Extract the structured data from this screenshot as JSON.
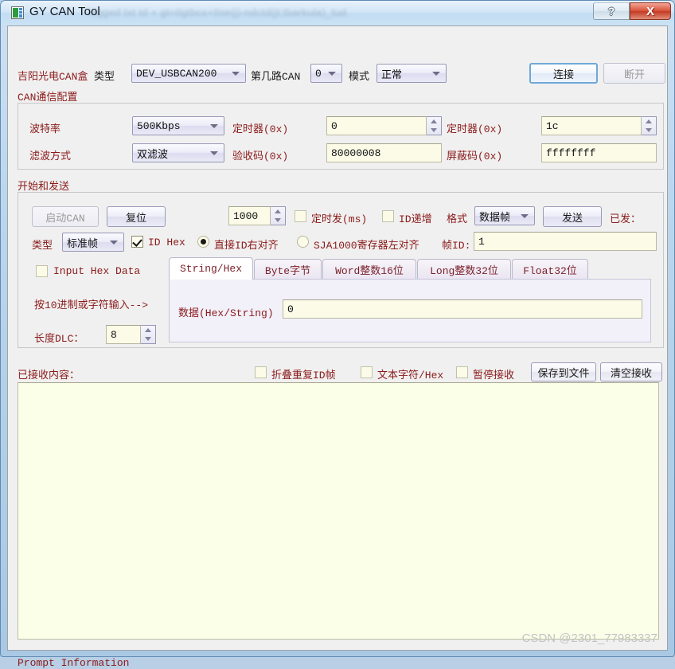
{
  "window": {
    "title": "GY CAN Tool",
    "ghost_title": "logged  txt  td + gt=tlgtbcx+tlse(j)-ndctd(jt;tbarkula)_tud",
    "help_label": "?",
    "close_label": "X"
  },
  "device_row": {
    "brand_label": "吉阳光电CAN盒",
    "type_label": "类型",
    "type_value": "DEV_USBCAN200",
    "channel_label": "第几路CAN",
    "channel_value": "0",
    "mode_label": "模式",
    "mode_value": "正常",
    "connect_label": "连接",
    "disconnect_label": "断开"
  },
  "can_config": {
    "group_title": "CAN通信配置",
    "baud_label": "波特率",
    "baud_value": "500Kbps",
    "timer0_label": "定时器(0x)",
    "timer0_value": "0",
    "timer1_label": "定时器(0x)",
    "timer1_value": "1c",
    "filter_label": "滤波方式",
    "filter_value": "双滤波",
    "acccode_label": "验收码(0x)",
    "acccode_value": "80000008",
    "maskcode_label": "屏蔽码(0x)",
    "maskcode_value": "ffffffff"
  },
  "send": {
    "group_title": "开始和发送",
    "start_can_label": "启动CAN",
    "reset_label": "复位",
    "interval_value": "1000",
    "timed_send_label": "定时发(ms)",
    "id_increment_label": "ID递增",
    "format_label": "格式",
    "format_value": "数据帧",
    "send_label": "发送",
    "sent_count_label": "已发：",
    "type_label": "类型",
    "type_value": "标准帧",
    "id_hex_label": "ID Hex",
    "align_right_label": "直接ID右对齐",
    "align_left_label": "SJA1000寄存器左对齐",
    "frame_id_label": "帧ID:",
    "frame_id_value": "1",
    "input_hex_label": "Input Hex Data",
    "decimal_hint_label": "按10进制或字符输入-->",
    "dlc_label": "长度DLC：",
    "dlc_value": "8",
    "tabs": [
      {
        "label": "String/Hex",
        "active": true
      },
      {
        "label": "Byte字节",
        "active": false
      },
      {
        "label": "Word整数16位",
        "active": false
      },
      {
        "label": "Long整数32位",
        "active": false
      },
      {
        "label": "Float32位",
        "active": false
      }
    ],
    "data_label": "数据(Hex/String)",
    "data_value": "0"
  },
  "receive": {
    "title": "已接收内容：",
    "fold_repeat_label": "折叠重复ID帧",
    "text_hex_label": "文本字符/Hex",
    "pause_label": "暂停接收",
    "save_file_label": "保存到文件",
    "clear_label": "清空接收",
    "content": ""
  },
  "status": {
    "prompt": "Prompt Information",
    "watermark": "CSDN @2301_77983337"
  },
  "colors": {
    "label_red": "#8b1a1a",
    "field_bg": "#fbfbe8",
    "accent_blue": "#6fa8d8",
    "close_red": "#c43a22"
  }
}
